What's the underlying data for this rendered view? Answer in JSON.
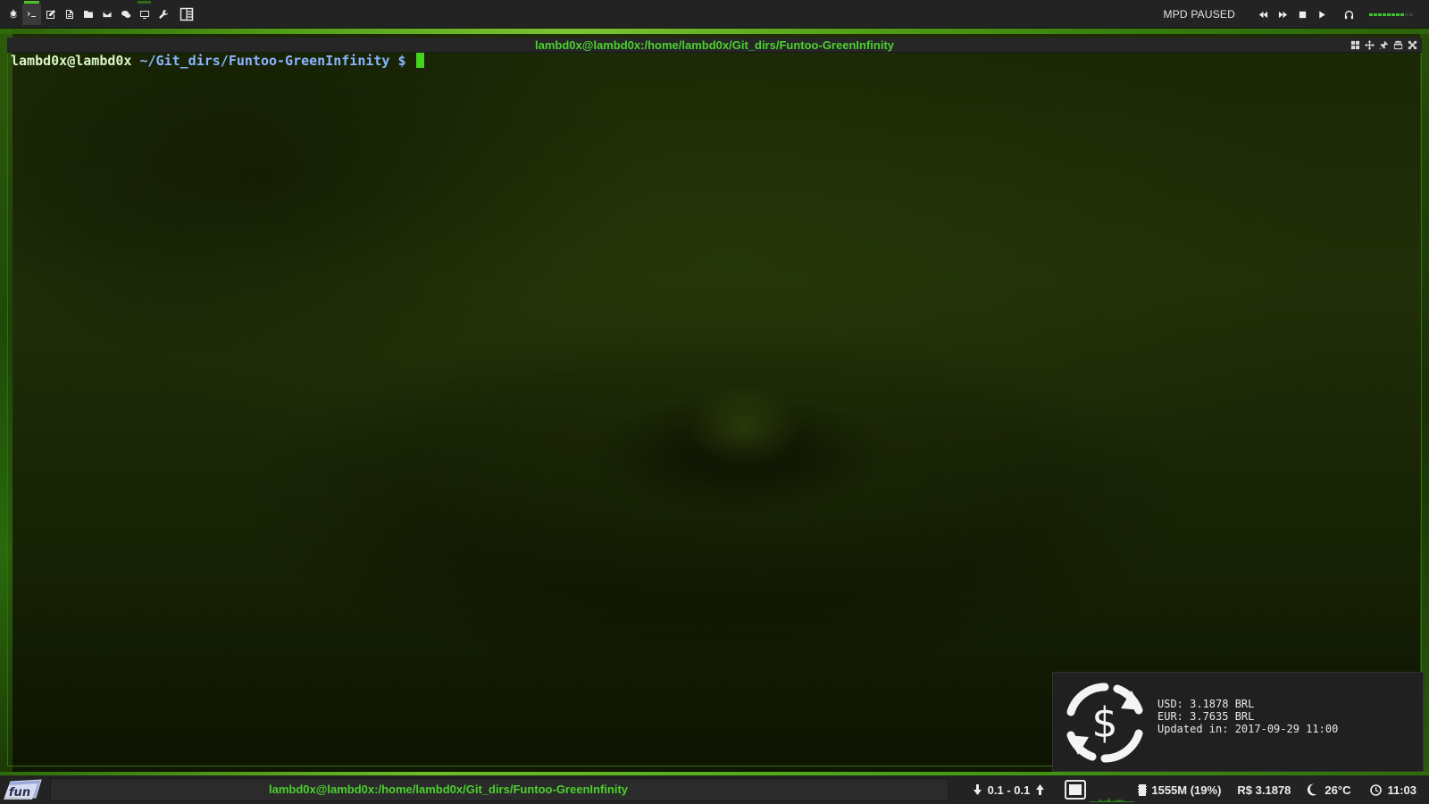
{
  "topbar": {
    "launchers": [
      {
        "icon": "power-icon"
      },
      {
        "icon": "terminal-icon"
      },
      {
        "icon": "edit-icon"
      },
      {
        "icon": "document-icon"
      },
      {
        "icon": "folder-icon"
      },
      {
        "icon": "mail-icon"
      },
      {
        "icon": "chat-icon"
      },
      {
        "icon": "monitor-icon"
      },
      {
        "icon": "tools-icon"
      }
    ],
    "layout_icon": "tile-layout-icon",
    "mpd_status": "MPD PAUSED",
    "player_controls": [
      "rewind-icon",
      "fast-forward-icon",
      "stop-icon",
      "play-icon"
    ],
    "headphones_icon": "headphones-icon",
    "volume_level": 0.8
  },
  "terminal": {
    "title": "lambd0x@lambd0x:/home/lambd0x/Git_dirs/Funtoo-GreenInfinity",
    "prompt_user": "lambd0x@lambd0x",
    "prompt_path": "~/Git_dirs/Funtoo-GreenInfinity",
    "prompt_symbol": "$",
    "controls": [
      "tile-icon",
      "move-icon",
      "pin-icon",
      "maximize-icon",
      "close-icon"
    ]
  },
  "notification": {
    "icon": "currency-exchange-icon",
    "line1": "USD: 3.1878 BRL",
    "line2": "EUR: 3.7635 BRL",
    "line3": "Updated in: 2017-09-29 11:00"
  },
  "bottombar": {
    "logo_text": "fun",
    "task_title": "lambd0x@lambd0x:/home/lambd0x/Git_dirs/Funtoo-GreenInfinity",
    "net": "0.1 - 0.1",
    "memory": "1555M (19%)",
    "brl": "R$ 3.1878",
    "temperature": "26°C",
    "clock": "11:03"
  },
  "colors": {
    "accent": "#4bd12c",
    "prompt_path": "#8ab4ff",
    "cursor": "#46d21e",
    "bar_bg": "#232323"
  }
}
